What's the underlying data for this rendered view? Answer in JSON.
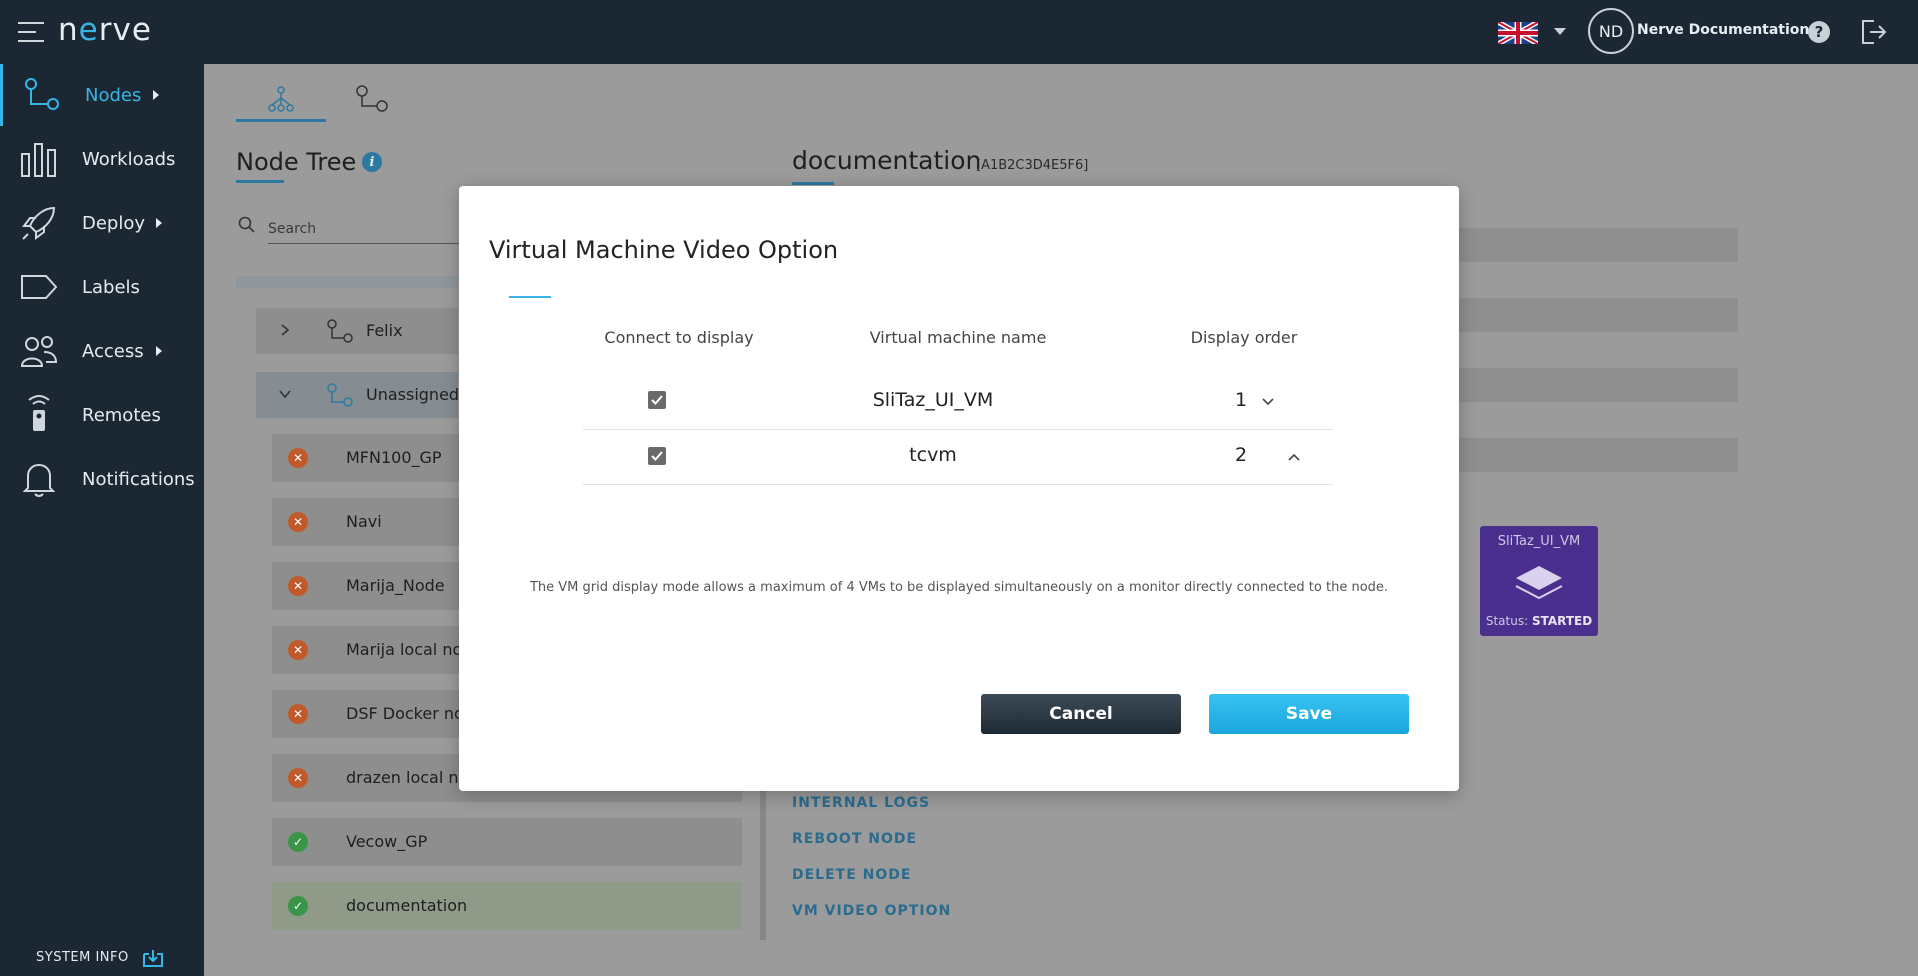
{
  "app": {
    "logo_text_pre": "n",
    "logo_text_e": "e",
    "logo_text_post": "rve"
  },
  "header": {
    "language_flag": "united-kingdom-flag",
    "avatar_initials": "ND",
    "username": "Nerve Documentation",
    "help_glyph": "?"
  },
  "sidebar": {
    "items": [
      {
        "label": "Nodes",
        "icon": "nodes-icon",
        "has_submenu": true,
        "active": true
      },
      {
        "label": "Workloads",
        "icon": "workloads-icon",
        "has_submenu": false
      },
      {
        "label": "Deploy",
        "icon": "deploy-icon",
        "has_submenu": true
      },
      {
        "label": "Labels",
        "icon": "labels-icon",
        "has_submenu": false
      },
      {
        "label": "Access",
        "icon": "access-icon",
        "has_submenu": true
      },
      {
        "label": "Remotes",
        "icon": "remotes-icon",
        "has_submenu": false
      },
      {
        "label": "Notifications",
        "icon": "notifications-icon",
        "has_submenu": false
      }
    ],
    "system_info": "SYSTEM INFO"
  },
  "main": {
    "title": "Node Tree",
    "info_glyph": "i",
    "search_placeholder": "Search",
    "tree": [
      {
        "label": "Felix",
        "expanded": false
      },
      {
        "label": "Unassigned",
        "expanded": true
      }
    ],
    "nodes": [
      {
        "label": "MFN100_GP",
        "status": "error"
      },
      {
        "label": "Navi",
        "status": "error"
      },
      {
        "label": "Marija_Node",
        "status": "error"
      },
      {
        "label": "Marija local node",
        "status": "error"
      },
      {
        "label": "DSF Docker node",
        "status": "error"
      },
      {
        "label": "drazen local node",
        "status": "error"
      },
      {
        "label": "Vecow_GP",
        "status": "ok"
      },
      {
        "label": "documentation",
        "status": "ok",
        "selected": true
      }
    ]
  },
  "detail": {
    "title": "documentation",
    "id": "[A1B2C3D4E5F6]",
    "vm_tile": {
      "name": "SliTaz_UI_VM",
      "status_label": "Status:",
      "status_value": "STARTED"
    },
    "actions": [
      "INTERNAL LOGS",
      "REBOOT NODE",
      "DELETE NODE",
      "VM VIDEO OPTION"
    ]
  },
  "modal": {
    "title": "Virtual Machine Video Option",
    "columns": {
      "connect": "Connect to display",
      "name": "Virtual machine name",
      "order": "Display order"
    },
    "rows": [
      {
        "connected": true,
        "name": "SliTaz_UI_VM",
        "order": "1",
        "chevron": "down"
      },
      {
        "connected": true,
        "name": "tcvm",
        "order": "2",
        "chevron": "up"
      }
    ],
    "note": "The VM grid display mode allows a maximum of 4 VMs to be displayed simultaneously on a monitor directly connected to the node.",
    "cancel_label": "Cancel",
    "save_label": "Save"
  },
  "colors": {
    "topbar": "#1b2833",
    "accent": "#37b6e6",
    "vm_tile": "#4a2f8f",
    "error": "#c05a2a",
    "ok": "#3a9548"
  }
}
